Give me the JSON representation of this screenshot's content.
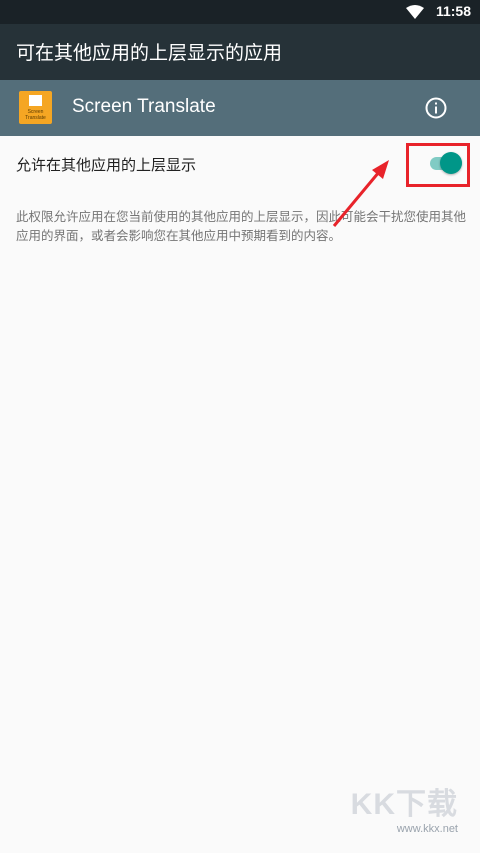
{
  "status_bar": {
    "time": "11:58",
    "wifi_icon": "wifi-icon"
  },
  "app_bar": {
    "title": "可在其他应用的上层显示的应用"
  },
  "app_header": {
    "app_name": "Screen Translate",
    "icon_text_line1": "Screen",
    "icon_text_line2": "Translate",
    "info_icon": "info-icon"
  },
  "setting": {
    "label": "允许在其他应用的上层显示",
    "enabled": true,
    "description": "此权限允许应用在您当前使用的其他应用的上层显示，因此可能会干扰您使用其他应用的界面，或者会影响您在其他应用中预期看到的内容。"
  },
  "watermark": {
    "logo": "KK下载",
    "url": "www.kkx.net"
  },
  "colors": {
    "status_bar": "#1a2227",
    "app_bar": "#263238",
    "app_header": "#546e7a",
    "toggle_on": "#009688",
    "annotation": "#e8232a"
  }
}
